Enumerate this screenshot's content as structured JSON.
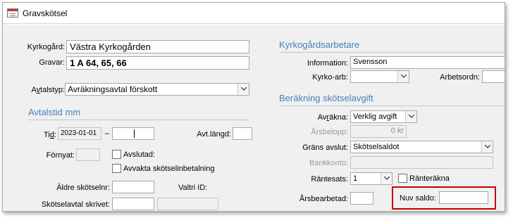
{
  "window": {
    "title": "Gravskötsel",
    "icon": "form-icon"
  },
  "left": {
    "kyrkogard": {
      "label": "Kyrkogård:",
      "value": "Västra Kyrkogården"
    },
    "gravar": {
      "label": "Gravar:",
      "value": "1 A     64, 65, 66"
    },
    "avtalstyp": {
      "label": "Avtalstyp:",
      "value": "Avräkningsavtal förskott"
    },
    "avtalstid_header": "Avtalstid mm",
    "tid": {
      "label": "Tid:",
      "from": "2023-01-01",
      "separator": "–",
      "to": ""
    },
    "avt_langd": {
      "label": "Avt.längd:",
      "value": ""
    },
    "fornyat": {
      "label": "Förnyat:",
      "value": ""
    },
    "avslutad": {
      "label": "Avslutad:",
      "checked": false
    },
    "avvakta": {
      "label": "Avvakta skötselinbetalning",
      "checked": false
    },
    "aldre_skotselnr": {
      "label": "Äldre skötselnr:",
      "value": ""
    },
    "valtri_id": {
      "label": "Valtri ID:",
      "value": ""
    },
    "skotselavtal_skrivet": {
      "label": "Skötselavtal skrivet:",
      "value": "",
      "value2": ""
    }
  },
  "right": {
    "kyrkogardsarbetare_header": "Kyrkogårdsarbetare",
    "information": {
      "label": "Information:",
      "value": "Svensson"
    },
    "kyrko_arb": {
      "label": "Kyrko-arb:",
      "value": ""
    },
    "arbetsordn": {
      "label": "Arbetsordn:",
      "value": ""
    },
    "berakning_header": "Beräkning skötselavgift",
    "avrakna": {
      "label": "Avräkna:",
      "value": "Verklig avgift"
    },
    "arsbelopp": {
      "label": "Årsbelopp:",
      "value": "0 kr"
    },
    "grans_avslut": {
      "label": "Gräns avslut:",
      "value": "Skötselsaldot"
    },
    "bankkonto": {
      "label": "Bankkonto:",
      "value": ""
    },
    "rantesats": {
      "label": "Räntesats:",
      "value": "1"
    },
    "rantrakna": {
      "label": "Ränteräkna",
      "checked": false
    },
    "arsbearbetad": {
      "label": "Årsbearbetad:",
      "value": ""
    },
    "nuv_saldo": {
      "label": "Nuv saldo:",
      "value": ""
    }
  },
  "colors": {
    "section_header": "#4a7ebb",
    "highlight": "#c00000",
    "form_bg": "#f0f0f0"
  }
}
